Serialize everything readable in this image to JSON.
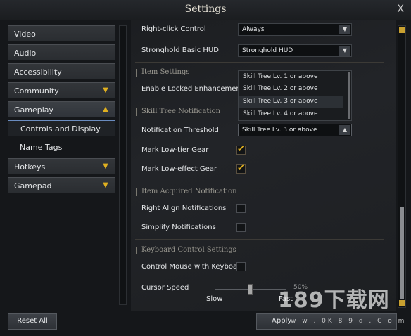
{
  "window": {
    "title": "Settings",
    "close_glyph": "X"
  },
  "sidebar": {
    "items": [
      {
        "label": "Video"
      },
      {
        "label": "Audio"
      },
      {
        "label": "Accessibility"
      },
      {
        "label": "Community",
        "chevron": "down"
      },
      {
        "label": "Gameplay",
        "chevron": "up",
        "expanded": true
      },
      {
        "label": "Controls and Display",
        "selected": true
      },
      {
        "label": "Name Tags"
      },
      {
        "label": "Hotkeys",
        "chevron": "down"
      },
      {
        "label": "Gamepad",
        "chevron": "down"
      }
    ]
  },
  "settings": {
    "right_click": {
      "label": "Right-click Control",
      "value": "Always"
    },
    "stronghold_hud": {
      "label": "Stronghold Basic HUD",
      "value": "Stronghold HUD"
    },
    "item_settings": {
      "title": "Item Settings"
    },
    "locked_enhancements": {
      "label": "Enable Locked Enhancements"
    },
    "skill_tree": {
      "title": "Skill Tree Notification"
    },
    "threshold": {
      "label": "Notification Threshold",
      "value": "Skill Tree Lv. 3 or above"
    },
    "threshold_options": [
      "Skill Tree Lv. 1 or above",
      "Skill Tree Lv. 2 or above",
      "Skill Tree Lv. 3 or above",
      "Skill Tree Lv. 4 or above"
    ],
    "low_tier": {
      "label": "Mark Low-tier Gear",
      "checked": true
    },
    "low_effect": {
      "label": "Mark Low-effect Gear",
      "checked": true
    },
    "item_acquired": {
      "title": "Item Acquired Notification"
    },
    "right_align": {
      "label": "Right Align Notifications",
      "checked": false
    },
    "simplify": {
      "label": "Simplify Notifications",
      "checked": false
    },
    "keyboard": {
      "title": "Keyboard Control Settings"
    },
    "control_mouse": {
      "label": "Control Mouse with Keyboard",
      "checked": false
    },
    "cursor_speed": {
      "label": "Cursor Speed",
      "value": "50%",
      "min_label": "Slow",
      "max_label": "Fast"
    }
  },
  "footer": {
    "reset_label": "Reset All",
    "apply_label": "Apply"
  },
  "watermark": {
    "text": "189下载网",
    "url": "w w . 0K 8 9 d . C o m"
  },
  "colors": {
    "accent": "#e0b020",
    "selection_border": "#6a8cc0"
  },
  "icons": {
    "chevron_down": "▼",
    "chevron_up": "▲",
    "check": "✔"
  }
}
